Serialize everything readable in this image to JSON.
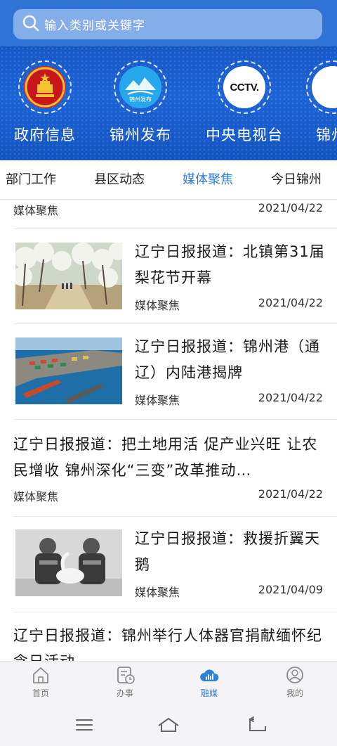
{
  "search": {
    "placeholder": "输入类别或关键字"
  },
  "channels": [
    {
      "label": "政府信息",
      "icon": "national-emblem-icon"
    },
    {
      "label": "锦州发布",
      "icon": "jinzhou-release-logo",
      "logo_text": "锦州发布"
    },
    {
      "label": "中央电视台",
      "icon": "cctv-logo",
      "logo_text": "CCTV."
    },
    {
      "label": "锦州",
      "icon": "partial-channel-icon"
    }
  ],
  "tabs": [
    {
      "label": "部门工作",
      "active": false
    },
    {
      "label": "县区动态",
      "active": false
    },
    {
      "label": "媒体聚焦",
      "active": true
    },
    {
      "label": "今日锦州",
      "active": false
    }
  ],
  "news": [
    {
      "title": "",
      "source": "媒体聚焦",
      "date": "2021/04/22",
      "thumb": "none"
    },
    {
      "title": "辽宁日报报道：北镇第31届梨花节开幕",
      "source": "媒体聚焦",
      "date": "2021/04/22",
      "thumb": "pear-blossom-orchard"
    },
    {
      "title": "辽宁日报报道：锦州港（通辽）内陆港揭牌",
      "source": "媒体聚焦",
      "date": "2021/04/22",
      "thumb": "port-aerial"
    },
    {
      "title": "辽宁日报报道：把土地用活 促产业兴旺 让农民增收 锦州深化“三变”改革推动…",
      "source": "媒体聚焦",
      "date": "2021/04/22",
      "thumb": "none"
    },
    {
      "title": "辽宁日报报道：救援折翼天鹅",
      "source": "媒体聚焦",
      "date": "2021/04/09",
      "thumb": "rescue-swan-bw"
    },
    {
      "title": "辽宁日报报道：锦州举行人体器官捐献缅怀纪念日活动",
      "source": "",
      "date": "",
      "thumb": "none"
    }
  ],
  "bottom_nav": [
    {
      "label": "首页",
      "icon": "home-icon",
      "active": false
    },
    {
      "label": "办事",
      "icon": "service-icon",
      "active": false
    },
    {
      "label": "融媒",
      "icon": "cloud-icon",
      "active": true
    },
    {
      "label": "我的",
      "icon": "profile-icon",
      "active": false
    }
  ],
  "colors": {
    "header": "#2f74d6",
    "accent": "#2f80d8",
    "banner": "#1c63d6"
  }
}
